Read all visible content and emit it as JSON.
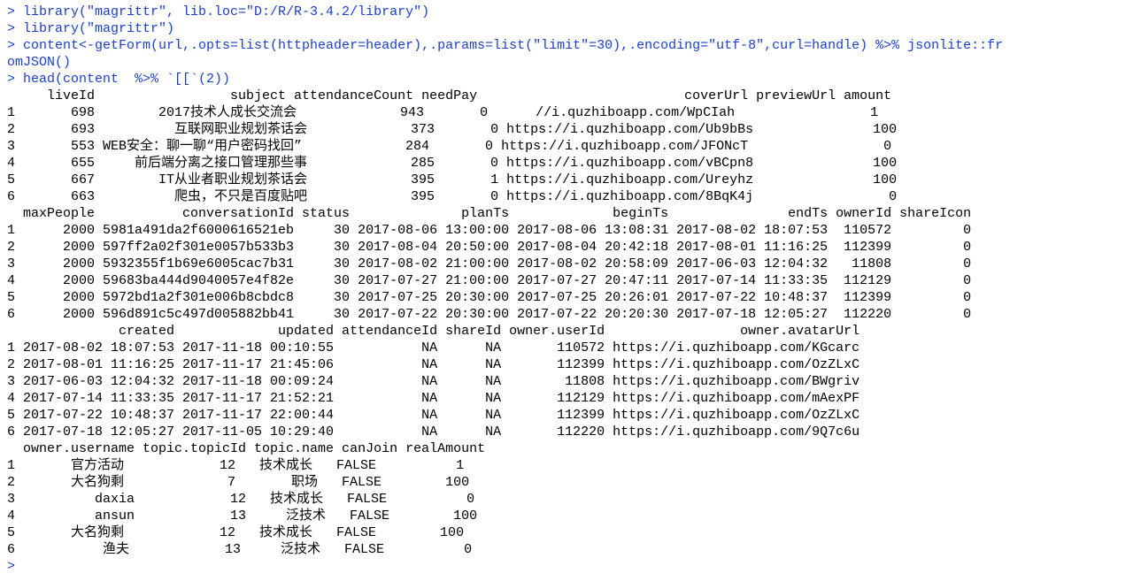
{
  "commands": [
    "> library(\"magrittr\", lib.loc=\"D:/R/R-3.4.2/library\")",
    "> library(\"magrittr\")",
    "> content<-getForm(url,.opts=list(httpheader=header),.params=list(\"limit\"=30),.encoding=\"utf-8\",curl=handle) %>% jsonlite::fr",
    "omJSON()",
    "> head(content  %>% `[[`(2))"
  ],
  "output": [
    "     liveId                 subject attendanceCount needPay                          coverUrl previewUrl amount",
    "1       698        2017技术人成长交流会             943       0      //i.quzhiboapp.com/WpCIah                 1",
    "2       693          互联网职业规划茶话会             373       0 https://i.quzhiboapp.com/Ub9bBs               100",
    "3       553 WEB安全：聊一聊“用户密码找回”             284       0 https://i.quzhiboapp.com/JFONcT                 0",
    "4       655     前后端分离之接口管理那些事             285       0 https://i.quzhiboapp.com/vBCpn8               100",
    "5       667        IT从业者职业规划茶话会             395       1 https://i.quzhiboapp.com/Ureyhz               100",
    "6       663          爬虫，不只是百度贴吧             395       0 https://i.quzhiboapp.com/8BqK4j                 0",
    "  maxPeople           conversationId status              planTs             beginTs               endTs ownerId shareIcon",
    "1      2000 5981a491da2f6000616521eb     30 2017-08-06 13:00:00 2017-08-06 13:08:31 2017-08-02 18:07:53  110572         0",
    "2      2000 597ff2a02f301e0057b533b3     30 2017-08-04 20:50:00 2017-08-04 20:42:18 2017-08-01 11:16:25  112399         0",
    "3      2000 5932355f1b69e6005cac7b31     30 2017-08-02 21:00:00 2017-08-02 20:58:09 2017-06-03 12:04:32   11808         0",
    "4      2000 59683ba444d9040057e4f82e     30 2017-07-27 21:00:00 2017-07-27 20:47:11 2017-07-14 11:33:35  112129         0",
    "5      2000 5972bd1a2f301e006b8cbdc8     30 2017-07-25 20:30:00 2017-07-25 20:26:01 2017-07-22 10:48:37  112399         0",
    "6      2000 596d891c5c497d005882bb41     30 2017-07-22 20:30:00 2017-07-22 20:20:30 2017-07-18 12:05:27  112220         0",
    "              created             updated attendanceId shareId owner.userId                 owner.avatarUrl",
    "1 2017-08-02 18:07:53 2017-11-18 00:10:55           NA      NA       110572 https://i.quzhiboapp.com/KGcarc",
    "2 2017-08-01 11:16:25 2017-11-17 21:45:06           NA      NA       112399 https://i.quzhiboapp.com/OzZLxC",
    "3 2017-06-03 12:04:32 2017-11-18 00:09:24           NA      NA        11808 https://i.quzhiboapp.com/BWgriv",
    "4 2017-07-14 11:33:35 2017-11-17 21:52:21           NA      NA       112129 https://i.quzhiboapp.com/mAexPF",
    "5 2017-07-22 10:48:37 2017-11-17 22:00:44           NA      NA       112399 https://i.quzhiboapp.com/OzZLxC",
    "6 2017-07-18 12:05:27 2017-11-05 10:29:40           NA      NA       112220 https://i.quzhiboapp.com/9Q7c6u",
    "  owner.username topic.topicId topic.name canJoin realAmount",
    "1       官方活动            12   技术成长   FALSE          1",
    "2       大名狗剩             7       职场   FALSE        100",
    "3          daxia            12   技术成长   FALSE          0",
    "4          ansun            13     泛技术   FALSE        100",
    "5       大名狗剩            12   技术成长   FALSE        100",
    "6           渔夫            13     泛技术   FALSE          0"
  ],
  "prompt": "> "
}
